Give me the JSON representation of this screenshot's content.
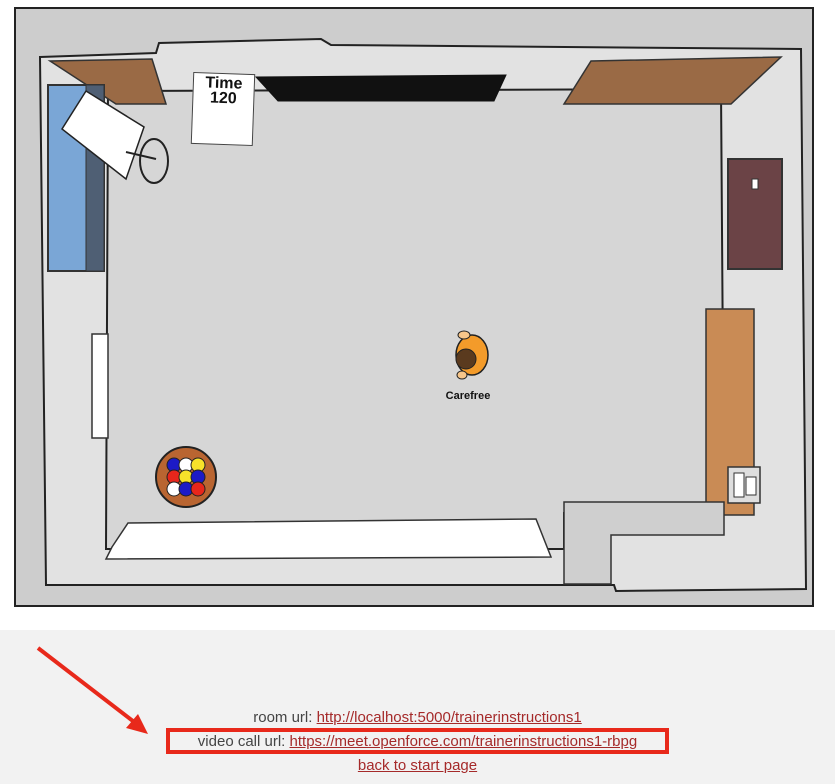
{
  "game": {
    "timer": {
      "title": "Time",
      "value": "120"
    },
    "player": {
      "name": "Carefree"
    }
  },
  "footer": {
    "room_url": {
      "label": "room url:",
      "link": "http://localhost:5000/trainerinstructions1"
    },
    "video_call_url": {
      "label": "video call url:",
      "link": "https://meet.openforce.com/trainerinstructions1-rbpg"
    },
    "back_link": "back to start page"
  },
  "colors": {
    "link": "#a52a2a",
    "annotation": "#e8291b",
    "floor": "#d3d3d3",
    "door": "#6b4346",
    "ball_colors": [
      "#e8261b",
      "#f7e22a",
      "#1c1ac7",
      "#ffffff"
    ]
  }
}
